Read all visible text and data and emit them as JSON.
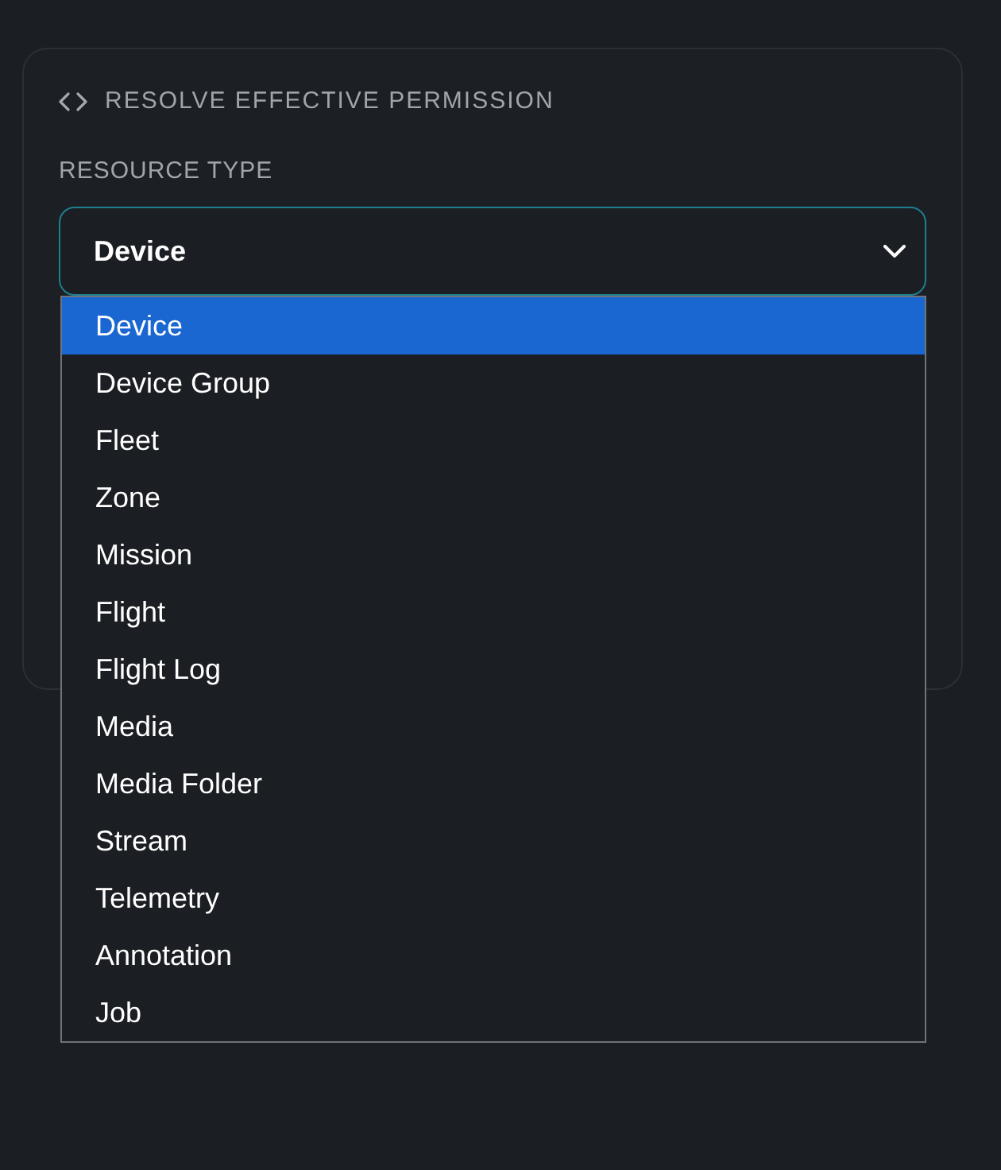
{
  "card": {
    "title": "RESOLVE EFFECTIVE PERMISSION"
  },
  "resource_type": {
    "label": "RESOURCE TYPE",
    "value": "Device",
    "expanded": true,
    "options": [
      {
        "label": "Device",
        "selected": true
      },
      {
        "label": "Device Group",
        "selected": false
      },
      {
        "label": "Fleet",
        "selected": false
      },
      {
        "label": "Zone",
        "selected": false
      },
      {
        "label": "Mission",
        "selected": false
      },
      {
        "label": "Flight",
        "selected": false
      },
      {
        "label": "Flight Log",
        "selected": false
      },
      {
        "label": "Media",
        "selected": false
      },
      {
        "label": "Media Folder",
        "selected": false
      },
      {
        "label": "Stream",
        "selected": false
      },
      {
        "label": "Telemetry",
        "selected": false
      },
      {
        "label": "Annotation",
        "selected": false
      },
      {
        "label": "Job",
        "selected": false
      }
    ]
  }
}
